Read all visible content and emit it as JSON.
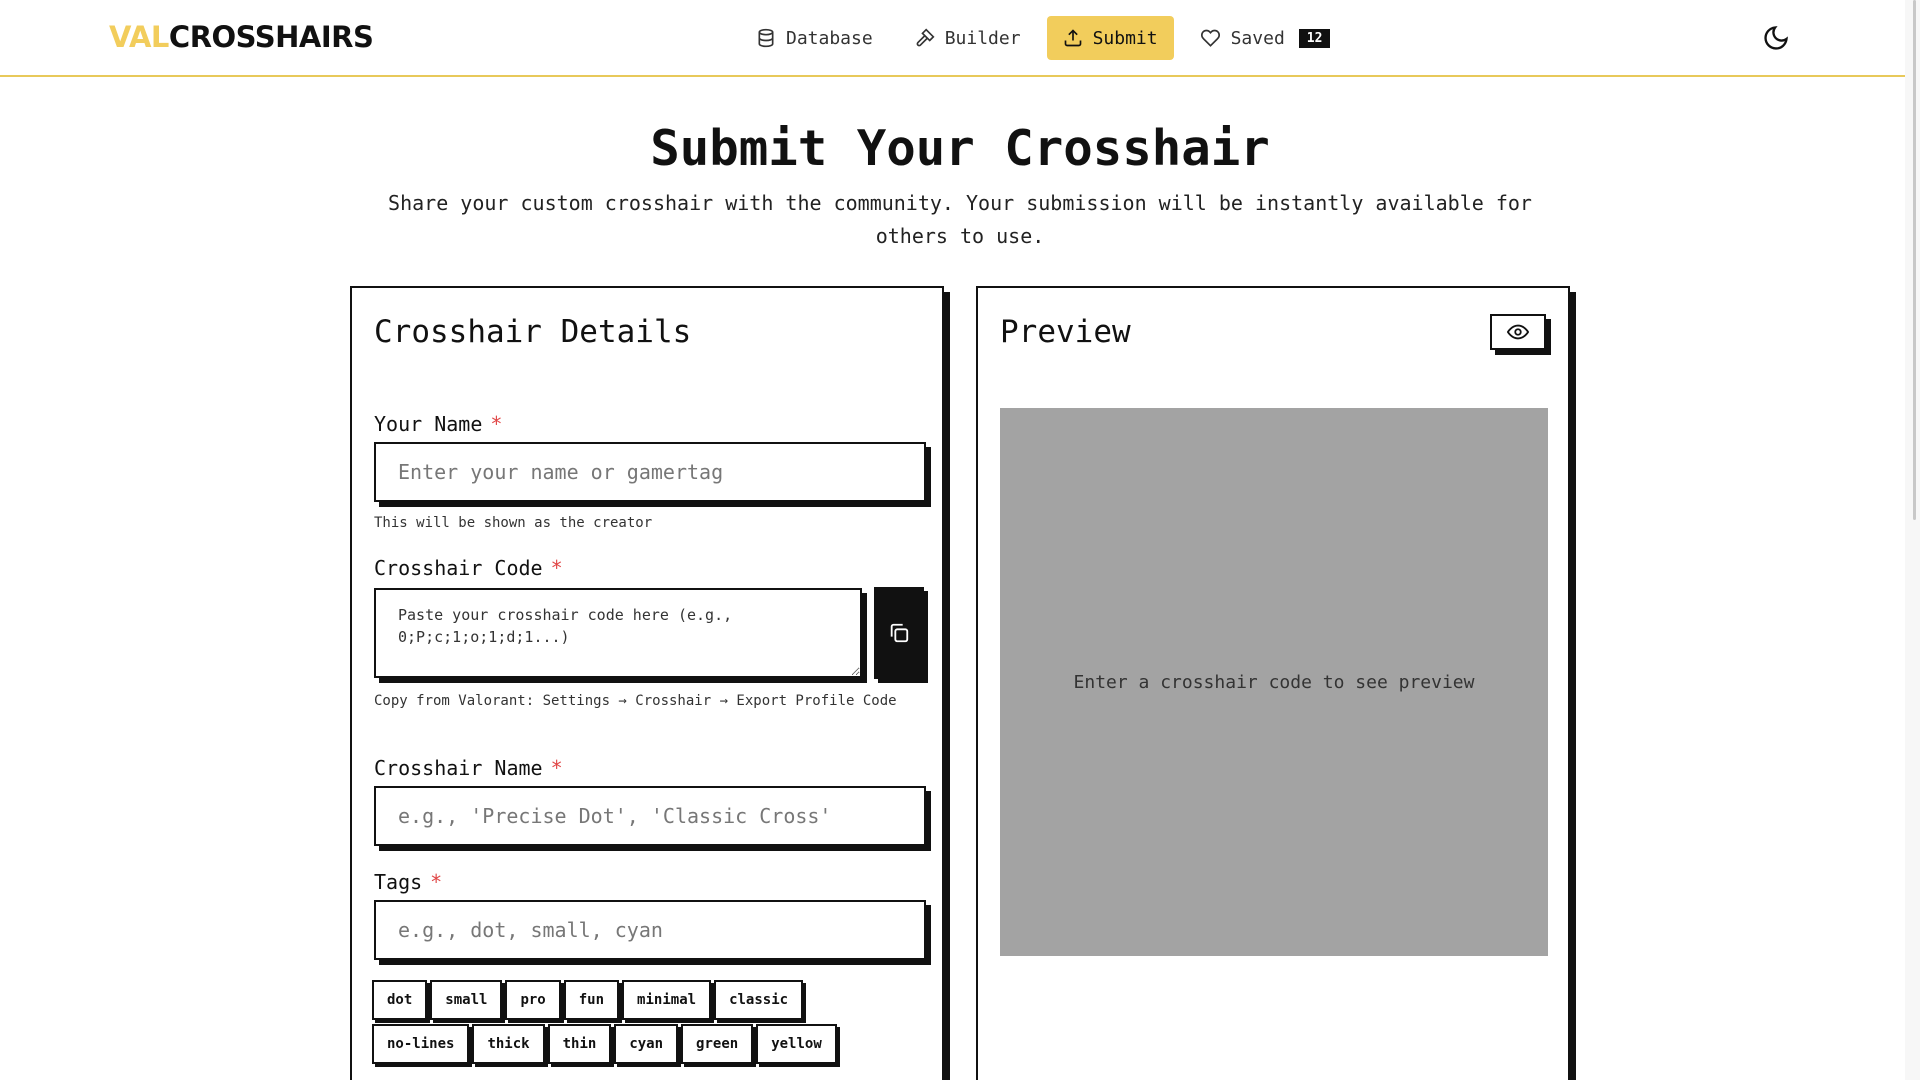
{
  "header": {
    "logo_val": "VAL",
    "logo_rest": "CROSSHAIRS",
    "nav": [
      {
        "label": "Database",
        "icon": "database-icon"
      },
      {
        "label": "Builder",
        "icon": "hammer-icon"
      },
      {
        "label": "Submit",
        "icon": "upload-icon",
        "active": true
      },
      {
        "label": "Saved",
        "icon": "heart-icon"
      }
    ],
    "saved_count": "12",
    "theme_icon": "moon-icon"
  },
  "page": {
    "title": "Submit Your Crosshair",
    "subtitle": "Share your custom crosshair with the community. Your submission will be instantly available for others to use."
  },
  "form": {
    "heading": "Crosshair Details",
    "required_mark": "*",
    "name_label": "Your Name",
    "name_placeholder": "Enter your name or gamertag",
    "name_hint": "This will be shown as the creator",
    "code_label": "Crosshair Code",
    "code_placeholder": "Paste your crosshair code here (e.g., 0;P;c;1;o;1;d;1...)",
    "code_hint": "Copy from Valorant: Settings → Crosshair → Export Profile Code",
    "crosshair_name_label": "Crosshair Name",
    "crosshair_name_placeholder": "e.g., 'Precise Dot', 'Classic Cross'",
    "tags_label": "Tags",
    "tags_placeholder": "e.g., dot, small, cyan",
    "tags_row1": [
      "dot",
      "small",
      "pro",
      "fun",
      "minimal",
      "classic"
    ],
    "tags_row2": [
      "no-lines",
      "thick",
      "thin",
      "cyan",
      "green",
      "yellow"
    ]
  },
  "preview": {
    "heading": "Preview",
    "empty_text": "Enter a crosshair code to see preview"
  },
  "colors": {
    "accent": "#f2cd5c",
    "preview_bg": "#a3a3a3",
    "required": "#e04545"
  }
}
